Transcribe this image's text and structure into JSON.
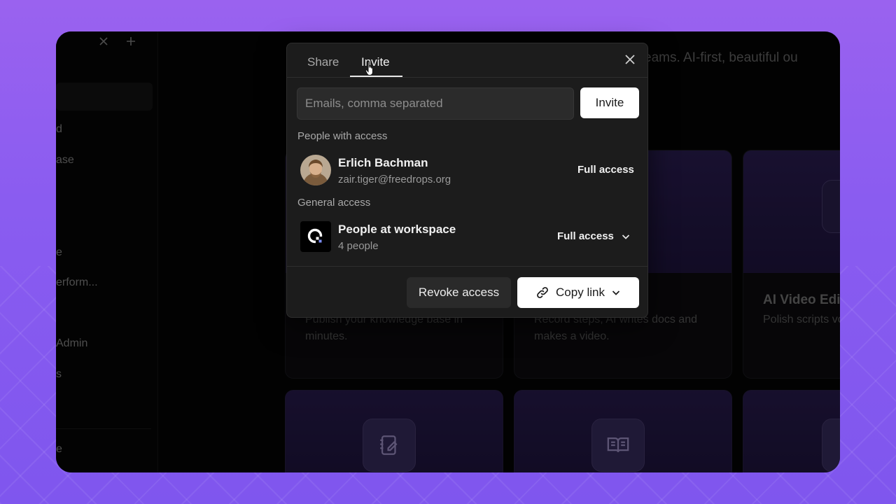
{
  "sidebar": {
    "top_icons": [
      "close-icon",
      "plus-icon"
    ],
    "items": [
      {
        "label": "d"
      },
      {
        "label": "ase"
      },
      {
        "label": "e"
      },
      {
        "label": "erform..."
      },
      {
        "label": "Admin"
      },
      {
        "label": "s"
      },
      {
        "label": "e"
      }
    ]
  },
  "main": {
    "hero_text": "ern teams. AI-first, beautiful ou",
    "cards": [
      {
        "title": "",
        "desc": "Publish your knowledge base in minutes."
      },
      {
        "title": "",
        "desc": "Record steps; AI writes docs and makes a video."
      },
      {
        "title": "AI Video Edi",
        "desc": "Polish scripts voiceover vid more."
      }
    ],
    "bottom_cards_icons": [
      "notebook-edit-icon",
      "book-open-icon",
      "card-icon"
    ]
  },
  "modal": {
    "tabs": [
      {
        "label": "Share"
      },
      {
        "label": "Invite"
      }
    ],
    "active_tab": "Invite",
    "email_input": {
      "placeholder": "Emails, comma separated",
      "value": ""
    },
    "invite_button": "Invite",
    "people_section_label": "People with access",
    "person": {
      "name": "Erlich Bachman",
      "email": "zair.tiger@freedrops.org",
      "access": "Full access"
    },
    "general_section_label": "General access",
    "workspace": {
      "name": "People at workspace",
      "count": "4 people",
      "access": "Full access"
    },
    "revoke_button": "Revoke access",
    "copy_link_button": "Copy link"
  },
  "colors": {
    "background": "#8a5cf0",
    "modal_bg": "#1c1c1c",
    "card_gradient": "#2d1f57"
  }
}
